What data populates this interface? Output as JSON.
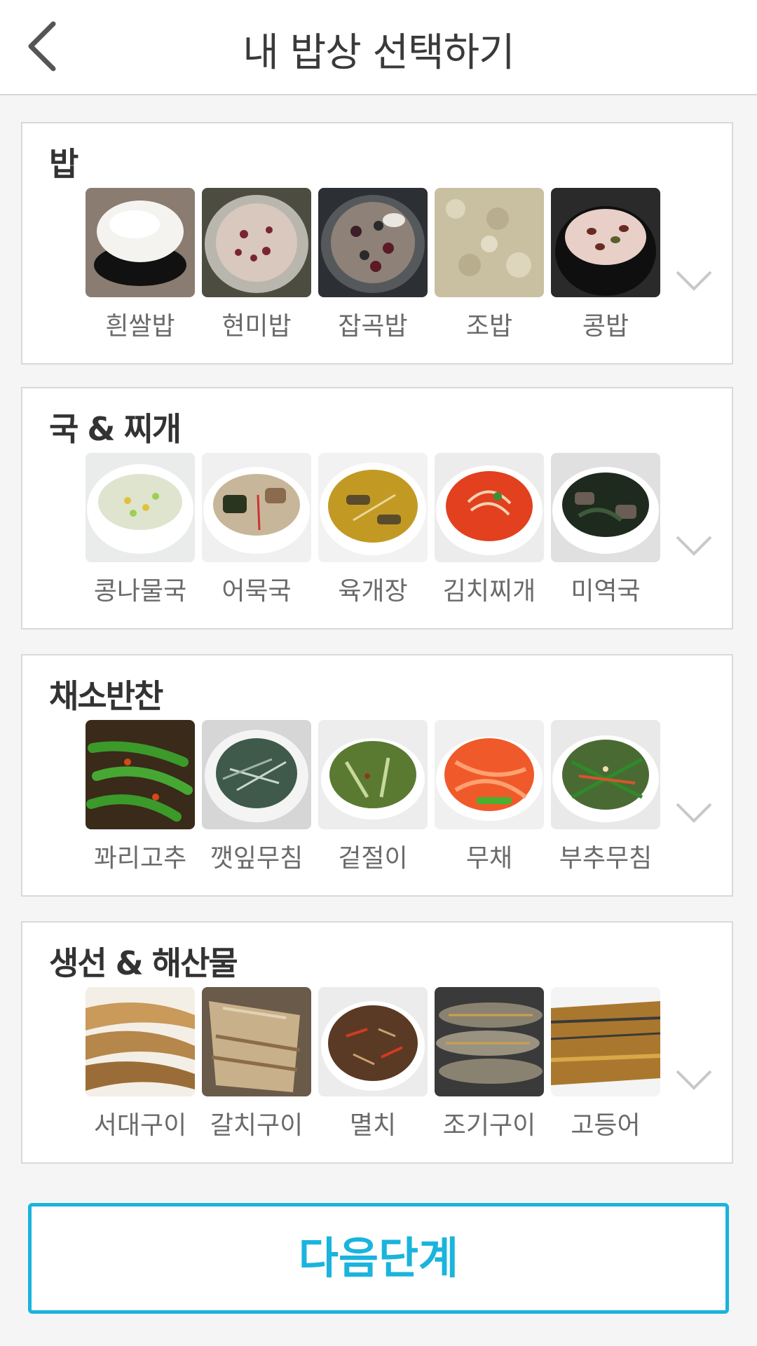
{
  "header": {
    "title": "내 밥상 선택하기",
    "back_icon": "chevron-left-icon"
  },
  "sections": [
    {
      "title": "밥",
      "items": [
        {
          "label": "흰쌀밥",
          "thumb": "white-rice"
        },
        {
          "label": "현미밥",
          "thumb": "brown-rice"
        },
        {
          "label": "잡곡밥",
          "thumb": "multigrain-rice"
        },
        {
          "label": "조밥",
          "thumb": "millet-rice"
        },
        {
          "label": "콩밥",
          "thumb": "bean-rice"
        }
      ]
    },
    {
      "title": "국 & 찌개",
      "items": [
        {
          "label": "콩나물국",
          "thumb": "bean-sprout-soup"
        },
        {
          "label": "어묵국",
          "thumb": "fishcake-soup"
        },
        {
          "label": "육개장",
          "thumb": "spicy-beef-soup"
        },
        {
          "label": "김치찌개",
          "thumb": "kimchi-stew"
        },
        {
          "label": "미역국",
          "thumb": "seaweed-soup"
        }
      ]
    },
    {
      "title": "채소반찬",
      "items": [
        {
          "label": "꽈리고추",
          "thumb": "shishito-pepper"
        },
        {
          "label": "깻잎무침",
          "thumb": "perilla-leaf"
        },
        {
          "label": "겉절이",
          "thumb": "geotjeori"
        },
        {
          "label": "무채",
          "thumb": "radish-salad"
        },
        {
          "label": "부추무침",
          "thumb": "chive-salad"
        }
      ]
    },
    {
      "title": "생선 & 해산물",
      "items": [
        {
          "label": "서대구이",
          "thumb": "grilled-sole"
        },
        {
          "label": "갈치구이",
          "thumb": "grilled-hairtail"
        },
        {
          "label": "멸치",
          "thumb": "anchovy"
        },
        {
          "label": "조기구이",
          "thumb": "grilled-croaker"
        },
        {
          "label": "고등어",
          "thumb": "mackerel"
        }
      ]
    }
  ],
  "expand_icon": "chevron-down-icon",
  "next_button": {
    "label": "다음단계"
  },
  "colors": {
    "accent": "#1ab4dd",
    "background": "#f5f5f5",
    "card_border": "#d9d9d9"
  }
}
